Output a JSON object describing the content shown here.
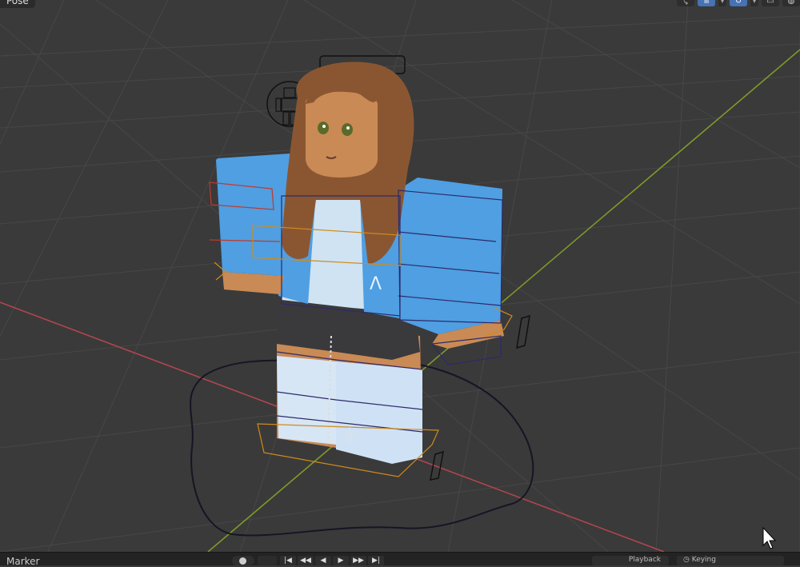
{
  "header": {
    "mode_label": "Pose",
    "tools": [
      {
        "name": "pivot-icon",
        "active": false
      },
      {
        "name": "snap-icon",
        "active": true
      },
      {
        "name": "proportional-edit-icon",
        "active": true
      },
      {
        "name": "overlay-icon",
        "active": false
      },
      {
        "name": "viewport-shading-icon",
        "active": false
      }
    ]
  },
  "timeline": {
    "menu_label": "Marker",
    "transport": [
      "|◀",
      "◀◀",
      "◀",
      "▶",
      "▶▶",
      "▶|"
    ],
    "playback_label": "Playback",
    "keying_label": "Keying"
  },
  "colors": {
    "viewport_bg": "#3a3a3a",
    "grid": "#474747",
    "x_axis": "#b04550",
    "y_axis": "#7f9a2a",
    "accent": "#4772b3",
    "jacket": "#4f9fe2",
    "skin": "#c98a55",
    "hair": "#8a5632"
  },
  "icons": {
    "cursor": "mouse-pointer-icon",
    "record": "record-icon",
    "keying": "keying-stopwatch-icon"
  }
}
